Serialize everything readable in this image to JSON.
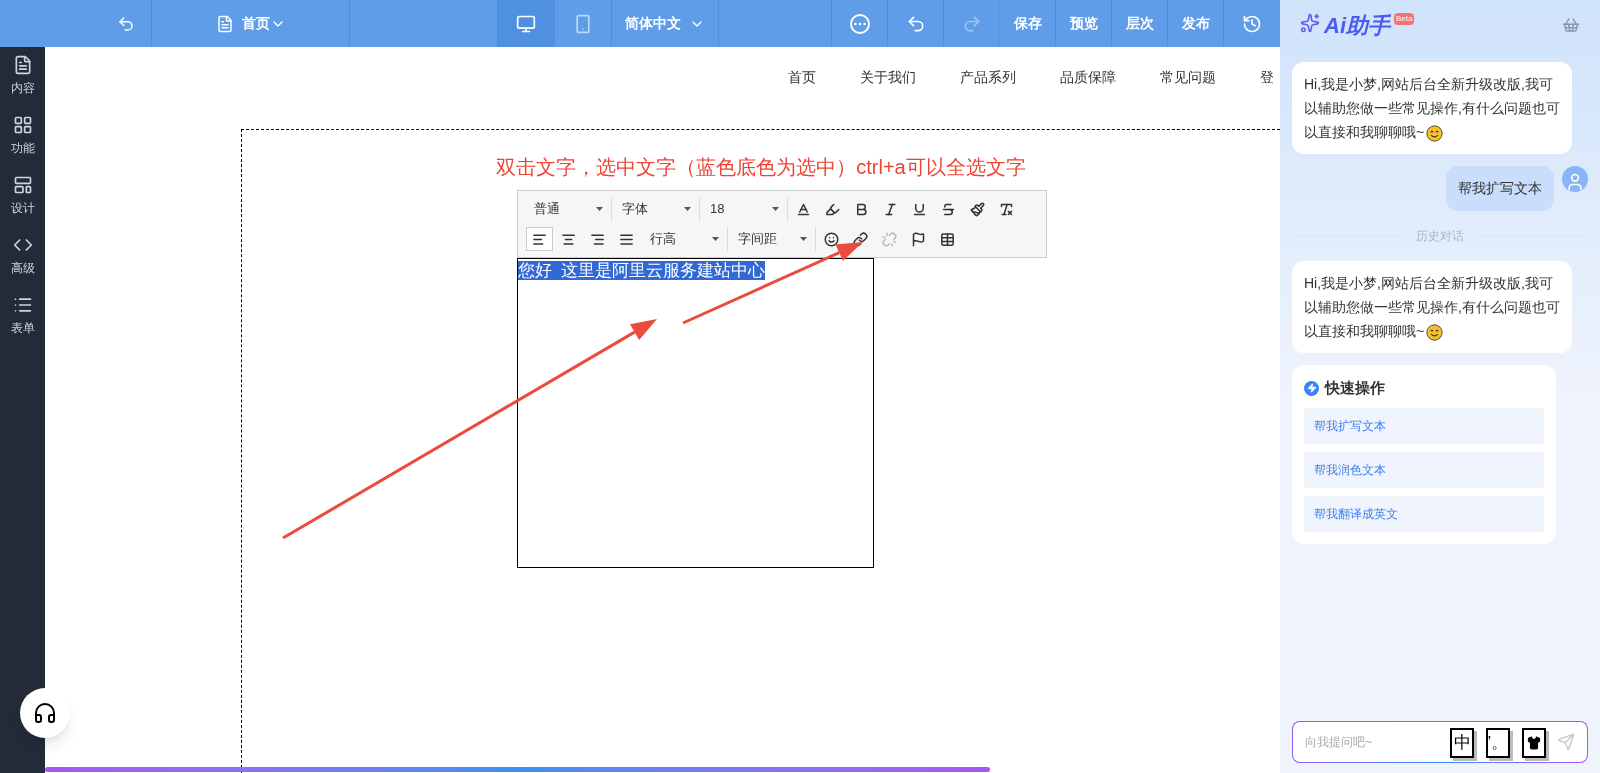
{
  "topbar": {
    "page_select": "首页",
    "devices": [
      {
        "kind": "desktop",
        "selected": true
      },
      {
        "kind": "mobile",
        "selected": false
      }
    ],
    "language": "简体中文",
    "redo_disabled": true,
    "actions": [
      "保存",
      "预览",
      "层次",
      "发布"
    ]
  },
  "sidebar": {
    "items": [
      {
        "kind": "content",
        "label": "内容"
      },
      {
        "kind": "function",
        "label": "功能"
      },
      {
        "kind": "design",
        "label": "设计"
      },
      {
        "kind": "advanced",
        "label": "高级"
      },
      {
        "kind": "form",
        "label": "表单"
      }
    ]
  },
  "canvas": {
    "nav": [
      "首页",
      "关于我们",
      "产品系列",
      "品质保障",
      "常见问题",
      "登"
    ],
    "instruction": "双击文字，选中文字（蓝色底色为选中）ctrl+a可以全选文字",
    "toolbar": [
      [
        {
          "kind": "select",
          "label": "普通"
        },
        {
          "kind": "select",
          "label": "字体"
        },
        {
          "kind": "select",
          "label": "18"
        },
        {
          "kind": "color",
          "selected": false,
          "disabled": false
        },
        {
          "kind": "highlight",
          "selected": false,
          "disabled": false
        },
        {
          "kind": "bold",
          "selected": false,
          "disabled": false
        },
        {
          "kind": "italic",
          "selected": false,
          "disabled": false
        },
        {
          "kind": "underline",
          "selected": false,
          "disabled": false
        },
        {
          "kind": "strike",
          "selected": false,
          "disabled": false
        },
        {
          "kind": "brush",
          "selected": false,
          "disabled": false
        },
        {
          "kind": "clear",
          "selected": false,
          "disabled": false
        }
      ],
      [
        {
          "kind": "left",
          "selected": true,
          "disabled": false
        },
        {
          "kind": "center",
          "selected": false,
          "disabled": false
        },
        {
          "kind": "right",
          "selected": false,
          "disabled": false
        },
        {
          "kind": "justify",
          "selected": false,
          "disabled": false
        },
        {
          "kind": "select",
          "label": "行高"
        },
        {
          "kind": "select",
          "label": "字间距"
        },
        {
          "kind": "emoji",
          "selected": false,
          "disabled": false
        },
        {
          "kind": "link",
          "selected": false,
          "disabled": false
        },
        {
          "kind": "unlink",
          "selected": false,
          "disabled": true
        },
        {
          "kind": "flag",
          "selected": false,
          "disabled": false
        },
        {
          "kind": "table",
          "selected": false,
          "disabled": false
        }
      ]
    ],
    "selected_text": "您好  这里是阿里云服务建站中心"
  },
  "assistant": {
    "title": "Ai助手",
    "badge": "Beta",
    "messages": [
      {
        "kind": "bot",
        "text": "Hi,我是小梦,网站后台全新升级改版,我可以辅助您做一些常见操作,有什么问题也可以直接和我聊聊哦~"
      },
      {
        "kind": "user",
        "text": "帮我扩写文本"
      },
      {
        "kind": "divider",
        "text": "历史对话"
      },
      {
        "kind": "bot",
        "text": "Hi,我是小梦,网站后台全新升级改版,我可以辅助您做一些常见操作,有什么问题也可以直接和我聊聊哦~"
      }
    ],
    "quick_title": "快速操作",
    "quick_actions": [
      "帮我扩写文本",
      "帮我润色文本",
      "帮我翻译成英文"
    ],
    "input": {
      "placeholder": "向我提问吧~"
    },
    "ime": [
      "中",
      "’。"
    ]
  }
}
